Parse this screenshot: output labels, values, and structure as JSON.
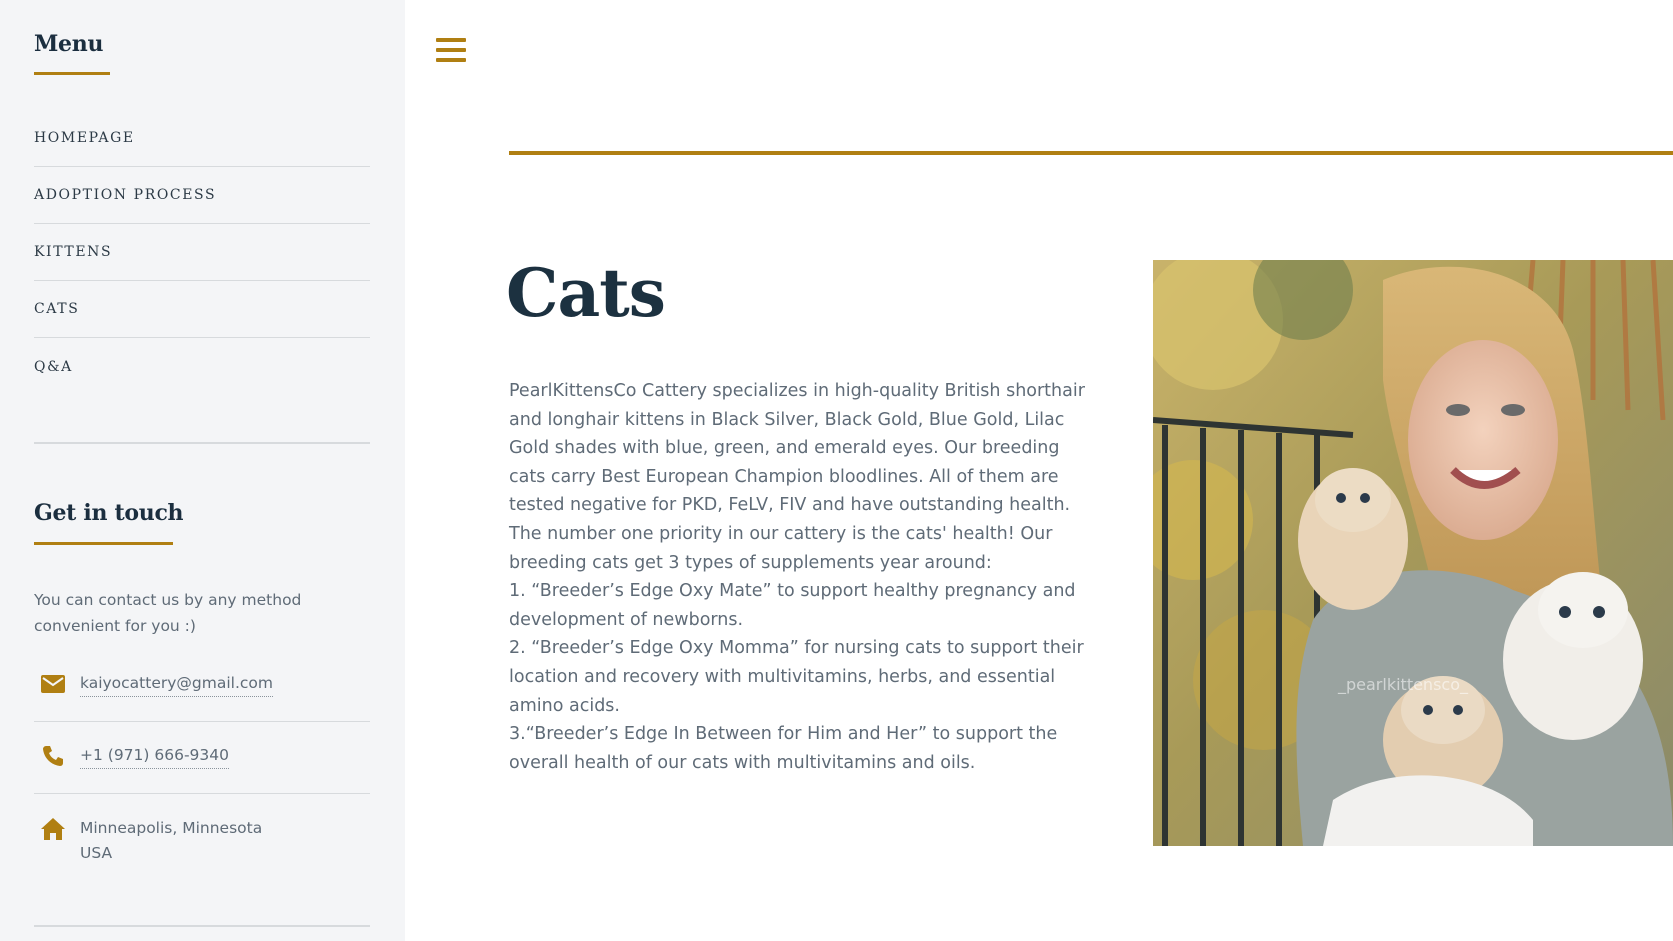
{
  "sidebar": {
    "menu_title": "Menu",
    "items": [
      {
        "label": "HOMEPAGE"
      },
      {
        "label": "ADOPTION PROCESS"
      },
      {
        "label": "KITTENS"
      },
      {
        "label": "CATS"
      },
      {
        "label": "Q&A"
      }
    ],
    "contact_title": "Get in touch",
    "contact_intro": "You can contact us by any method convenient for you :)",
    "email": "kaiyocattery@gmail.com",
    "phone": "+1 (971) 666-9340",
    "address_line1": "Minneapolis, Minnesota",
    "address_line2": "USA",
    "icons": {
      "email": "envelope-icon",
      "phone": "phone-icon",
      "address": "home-icon"
    }
  },
  "header": {
    "menu_icon": "hamburger-menu-icon"
  },
  "main": {
    "title": "Cats",
    "paragraphs": [
      "PearlKittensCo Cattery specializes in high-quality British shorthair and longhair kittens in Black Silver, Black Gold, Blue Gold, Lilac Gold shades with blue, green, and emerald eyes. Our breeding cats carry Best European Champion bloodlines. All of them are tested negative for PKD, FeLV, FIV and have outstanding health. The number one priority in our cattery is the cats' health! Our breeding cats get 3 types of supplements year around:",
      "1. “Breeder’s Edge Oxy Mate” to support healthy pregnancy and development of newborns.",
      "2. “Breeder’s Edge Oxy Momma” for nursing cats to support their location and recovery with multivitamins, herbs, and essential amino acids.",
      "3.“Breeder’s Edge In Between for Him and Her” to support the overall health of our cats with multivitamins and oils."
    ],
    "photo_watermark": "_pearlkittensco_"
  },
  "colors": {
    "accent": "#b07f12",
    "title": "#1c3140",
    "body_text": "#5f6b77",
    "sidebar_bg": "#f4f5f7"
  }
}
